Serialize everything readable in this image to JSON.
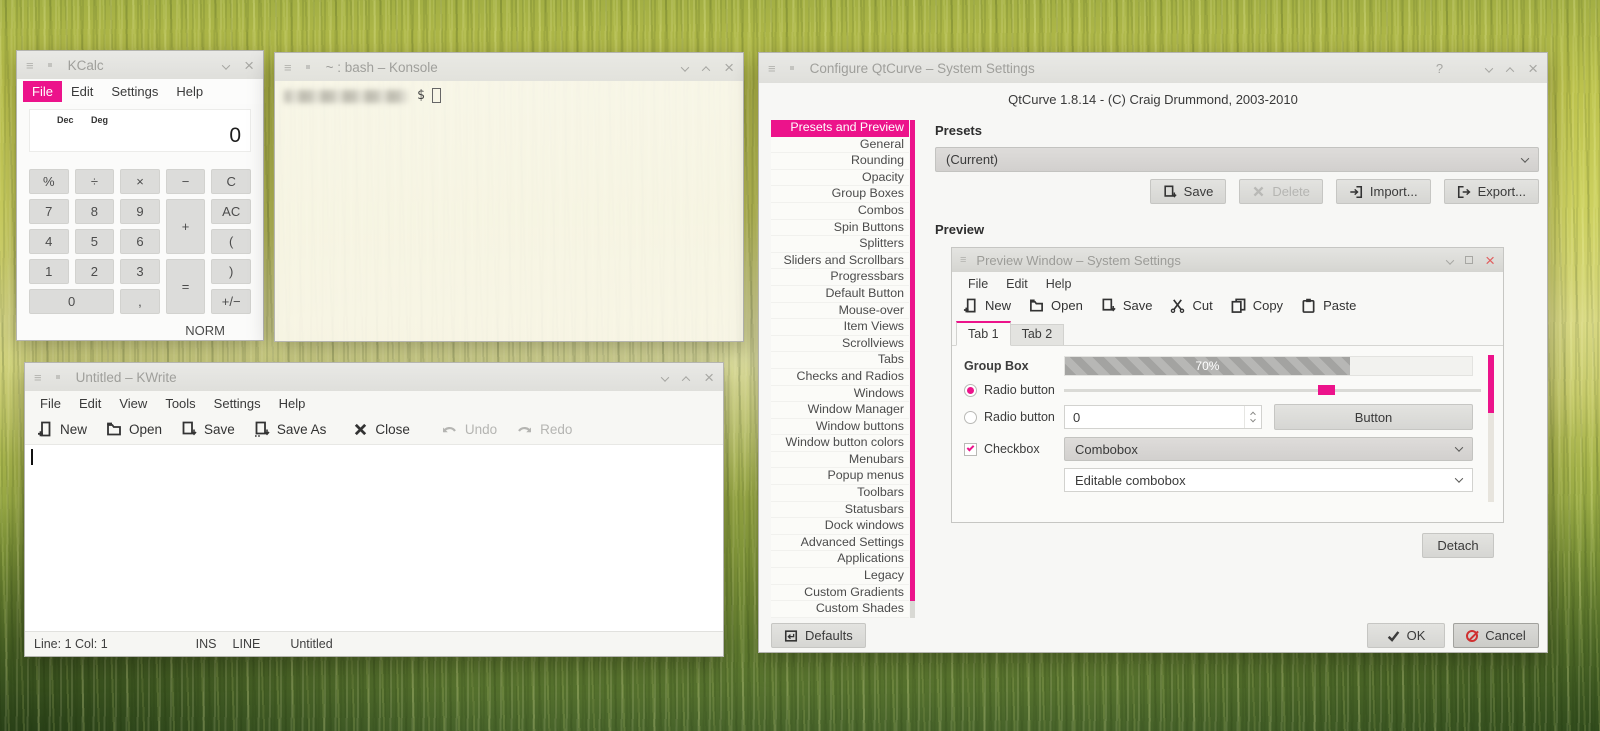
{
  "icons": {
    "window_menu": "≡",
    "close": "×",
    "help": "?"
  },
  "kcalc": {
    "title": "KCalc",
    "menu": [
      "File",
      "Edit",
      "Settings",
      "Help"
    ],
    "display": {
      "base_mode": "Dec",
      "angle_mode": "Deg",
      "value": "0"
    },
    "keys": {
      "percent": "%",
      "divide": "÷",
      "multiply": "×",
      "minus": "−",
      "clear": "C",
      "seven": "7",
      "eight": "8",
      "nine": "9",
      "plus": "+",
      "all_clear": "AC",
      "four": "4",
      "five": "5",
      "six": "6",
      "open_paren": "(",
      "one": "1",
      "two": "2",
      "three": "3",
      "equals": "=",
      "close_paren": ")",
      "zero": "0",
      "comma": ",",
      "plus_minus": "+/−"
    },
    "status": "NORM"
  },
  "konsole": {
    "title": "~ : bash – Konsole",
    "prompt": "$"
  },
  "kwrite": {
    "title": "Untitled – KWrite",
    "menu": [
      "File",
      "Edit",
      "View",
      "Tools",
      "Settings",
      "Help"
    ],
    "toolbar": {
      "new": "New",
      "open": "Open",
      "save": "Save",
      "save_as": "Save As",
      "close": "Close",
      "undo": "Undo",
      "redo": "Redo"
    },
    "status": {
      "cursor": "Line: 1 Col: 1",
      "insert_mode": "INS",
      "line_mode": "LINE",
      "document": "Untitled"
    }
  },
  "qtcurve": {
    "title": "Configure QtCurve – System Settings",
    "about": "QtCurve 1.8.14 - (C) Craig Drummond, 2003-2010",
    "sidebar_selected": "Presets and Preview",
    "sidebar": [
      "Presets and Preview",
      "General",
      "Rounding",
      "Opacity",
      "Group Boxes",
      "Combos",
      "Spin Buttons",
      "Splitters",
      "Sliders and Scrollbars",
      "Progressbars",
      "Default Button",
      "Mouse-over",
      "Item Views",
      "Scrollviews",
      "Tabs",
      "Checks and Radios",
      "Windows",
      "Window Manager",
      "Window buttons",
      "Window button colors",
      "Menubars",
      "Popup menus",
      "Toolbars",
      "Statusbars",
      "Dock windows",
      "Advanced Settings",
      "Applications",
      "Legacy",
      "Custom Gradients",
      "Custom Shades"
    ],
    "presets": {
      "heading": "Presets",
      "selected": "(Current)",
      "save": "Save",
      "delete": "Delete",
      "import": "Import...",
      "export": "Export..."
    },
    "preview": {
      "heading": "Preview",
      "window_title": "Preview Window – System Settings",
      "menu": [
        "File",
        "Edit",
        "Help"
      ],
      "toolbar": {
        "new": "New",
        "open": "Open",
        "save": "Save",
        "cut": "Cut",
        "copy": "Copy",
        "paste": "Paste"
      },
      "tabs": [
        "Tab 1",
        "Tab 2"
      ],
      "group_box": "Group Box",
      "progress_value": "70%",
      "radio1": "Radio button",
      "radio2": "Radio button",
      "spin_value": "0",
      "button": "Button",
      "checkbox": "Checkbox",
      "combobox": "Combobox",
      "editable_combobox": "Editable combobox",
      "detach": "Detach"
    },
    "defaults": "Defaults",
    "ok": "OK",
    "cancel": "Cancel"
  }
}
